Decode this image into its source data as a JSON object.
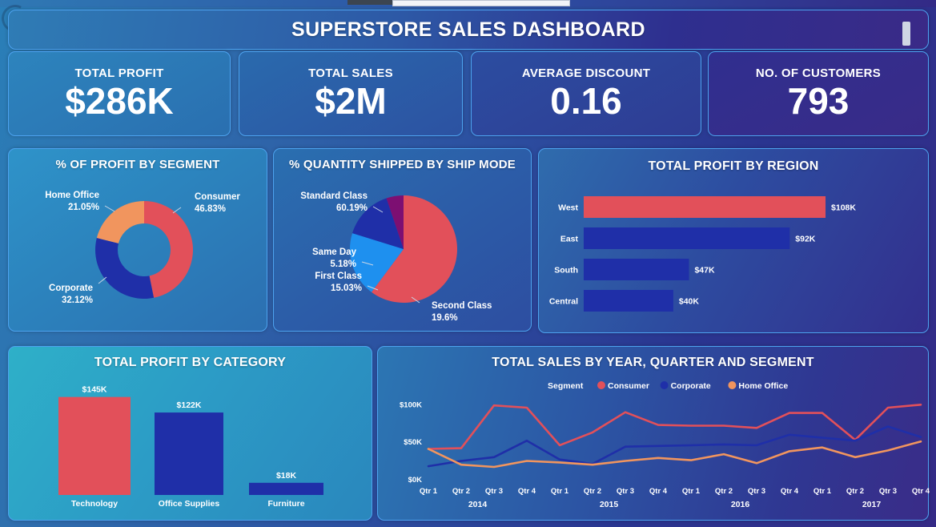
{
  "header": {
    "title": "SUPERSTORE SALES DASHBOARD",
    "right_marker": "nav-marker"
  },
  "kpis": [
    {
      "label": "TOTAL PROFIT",
      "value": "$286K"
    },
    {
      "label": "TOTAL SALES",
      "value": "$2M"
    },
    {
      "label": "AVERAGE DISCOUNT",
      "value": "0.16"
    },
    {
      "label": "NO. OF CUSTOMERS",
      "value": "793"
    }
  ],
  "colors": {
    "red": "#e2505a",
    "navy": "#1f2fa8",
    "orange": "#f1955e",
    "bright_blue": "#1e90ef",
    "purple": "#7d0f72",
    "card_border": "#4da3f0",
    "text": "#ffffff"
  },
  "chart_data": [
    {
      "id": "profit-by-segment",
      "type": "pie",
      "variant": "donut",
      "title": "% OF PROFIT BY SEGMENT",
      "categories": [
        "Consumer",
        "Corporate",
        "Home Office"
      ],
      "values": [
        46.83,
        32.12,
        21.05
      ],
      "value_labels": [
        "46.83%",
        "32.12%",
        "21.05%"
      ],
      "colors": [
        "#e2505a",
        "#1f2fa8",
        "#f1955e"
      ],
      "legend": "labels-outside",
      "start_angle": 0
    },
    {
      "id": "quantity-by-ship-mode",
      "type": "pie",
      "title": "% QUANTITY SHIPPED BY SHIP MODE",
      "categories": [
        "Standard Class",
        "Second Class",
        "First Class",
        "Same Day"
      ],
      "values": [
        60.19,
        19.6,
        15.03,
        5.18
      ],
      "value_labels": [
        "60.19%",
        "19.6%",
        "15.03%",
        "5.18%"
      ],
      "colors": [
        "#e2505a",
        "#1e90ef",
        "#1f2fa8",
        "#7d0f72"
      ],
      "legend": "labels-outside",
      "start_angle": 0
    },
    {
      "id": "profit-by-region",
      "type": "bar",
      "orientation": "horizontal",
      "title": "TOTAL PROFIT BY REGION",
      "categories": [
        "West",
        "East",
        "South",
        "Central"
      ],
      "values": [
        108,
        92,
        47,
        40
      ],
      "value_labels": [
        "$108K",
        "$92K",
        "$47K",
        "$40K"
      ],
      "colors": [
        "#e2505a",
        "#1f2fa8",
        "#1f2fa8",
        "#1f2fa8"
      ],
      "xlabel": "",
      "ylabel": "",
      "xlim": [
        0,
        118
      ],
      "grid": false
    },
    {
      "id": "profit-by-category",
      "type": "bar",
      "orientation": "vertical",
      "title": "TOTAL PROFIT BY CATEGORY",
      "categories": [
        "Technology",
        "Office Supplies",
        "Furniture"
      ],
      "values": [
        145,
        122,
        18
      ],
      "value_labels": [
        "$145K",
        "$122K",
        "$18K"
      ],
      "colors": [
        "#e2505a",
        "#1f2fa8",
        "#1f2fa8"
      ],
      "xlabel": "",
      "ylabel": "",
      "ylim": [
        0,
        160
      ],
      "grid": false
    },
    {
      "id": "sales-by-year-quarter-segment",
      "type": "line",
      "title": "TOTAL SALES BY YEAR, QUARTER AND SEGMENT",
      "legend_title": "Segment",
      "legend_position": "top-center",
      "x": [
        "Qtr 1",
        "Qtr 2",
        "Qtr 3",
        "Qtr 4",
        "Qtr 1",
        "Qtr 2",
        "Qtr 3",
        "Qtr 4",
        "Qtr 1",
        "Qtr 2",
        "Qtr 3",
        "Qtr 4",
        "Qtr 1",
        "Qtr 2",
        "Qtr 3",
        "Qtr 4"
      ],
      "year_groups": [
        {
          "label": "2014",
          "span": 4
        },
        {
          "label": "2015",
          "span": 4
        },
        {
          "label": "2016",
          "span": 4
        },
        {
          "label": "2017",
          "span": 4
        }
      ],
      "ytick_labels": [
        "$0K",
        "$50K",
        "$100K"
      ],
      "ytick_values": [
        0,
        50,
        100
      ],
      "ylim": [
        0,
        110
      ],
      "grid": false,
      "series": [
        {
          "name": "Consumer",
          "color": "#e2505a",
          "values": [
            40,
            41,
            98,
            95,
            45,
            62,
            89,
            72,
            71,
            71,
            68,
            88,
            88,
            52,
            95,
            99
          ]
        },
        {
          "name": "Corporate",
          "color": "#1f2fa8",
          "values": [
            17,
            24,
            29,
            51,
            26,
            20,
            43,
            44,
            45,
            46,
            45,
            59,
            55,
            51,
            70,
            56
          ]
        },
        {
          "name": "Home Office",
          "color": "#f1955e",
          "values": [
            40,
            19,
            16,
            24,
            22,
            19,
            24,
            28,
            25,
            33,
            21,
            37,
            42,
            29,
            38,
            50
          ]
        }
      ]
    }
  ]
}
